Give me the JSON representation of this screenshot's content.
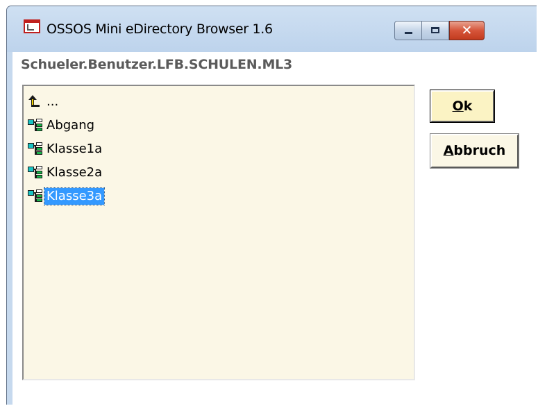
{
  "window": {
    "title": "OSSOS Mini eDirectory Browser 1.6",
    "app_icon": "app-window-icon",
    "controls": {
      "minimize_icon": "minimize-icon",
      "maximize_icon": "maximize-icon",
      "close_icon": "close-icon",
      "close_glyph": "✕"
    }
  },
  "path": {
    "current": "Schueler.Benutzer.LFB.SCHULEN.ML3"
  },
  "tree": {
    "items": [
      {
        "label": "...",
        "icon": "parent-up-icon",
        "selected": false
      },
      {
        "label": "Abgang",
        "icon": "org-unit-icon",
        "selected": false
      },
      {
        "label": "Klasse1a",
        "icon": "org-unit-icon",
        "selected": false
      },
      {
        "label": "Klasse2a",
        "icon": "org-unit-icon",
        "selected": false
      },
      {
        "label": "Klasse3a",
        "icon": "org-unit-icon",
        "selected": true
      }
    ]
  },
  "buttons": {
    "ok": {
      "mnemonic": "O",
      "rest": "k"
    },
    "abbruch": {
      "mnemonic": "A",
      "rest": "bbruch"
    }
  },
  "colors": {
    "tree_background": "#fbf7e6",
    "selection": "#3399ff",
    "titlebar": "#c6d9ee",
    "close_button": "#c23b1f"
  }
}
